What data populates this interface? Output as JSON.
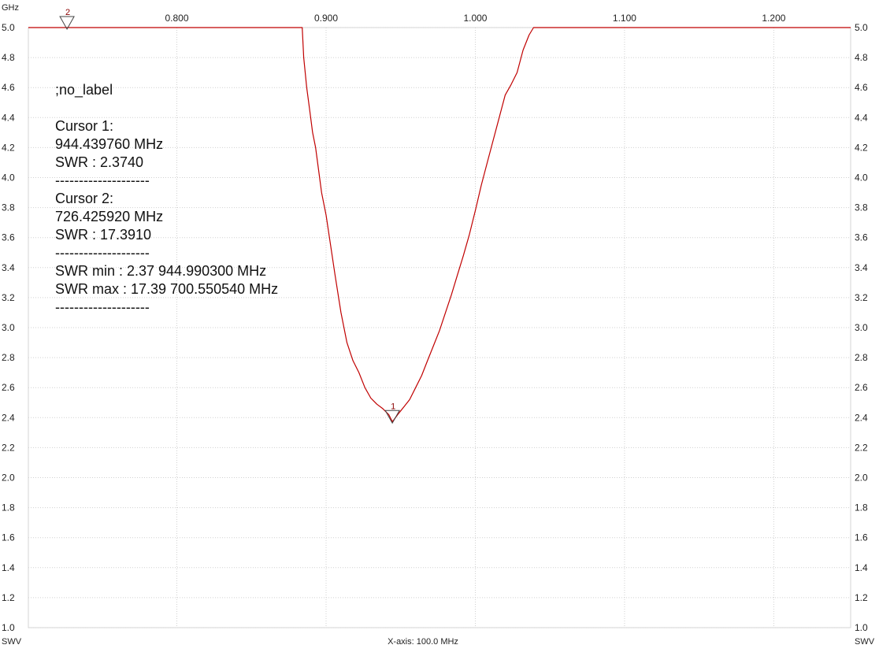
{
  "chart_data": {
    "type": "line",
    "title": "",
    "x_unit_label": "GHz",
    "y_unit_label": "SWV",
    "xlabel": "X-axis: 100.0 MHz",
    "x_range_ghz": [
      0.7005,
      1.2515
    ],
    "ylim": [
      1.0,
      5.0
    ],
    "x_ticks": [
      0.8,
      0.9,
      1.0,
      1.1,
      1.2
    ],
    "x_tick_labels": [
      "0.800",
      "0.900",
      "1.000",
      "1.100",
      "1.200"
    ],
    "y_ticks": [
      1.0,
      1.2,
      1.4,
      1.6,
      1.8,
      2.0,
      2.2,
      2.4,
      2.6,
      2.8,
      3.0,
      3.2,
      3.4,
      3.6,
      3.8,
      4.0,
      4.2,
      4.4,
      4.6,
      4.8,
      5.0
    ],
    "y_tick_labels": [
      "1.0",
      "1.2",
      "1.4",
      "1.6",
      "1.8",
      "2.0",
      "2.2",
      "2.4",
      "2.6",
      "2.8",
      "3.0",
      "3.2",
      "3.4",
      "3.6",
      "3.8",
      "4.0",
      "4.2",
      "4.4",
      "4.6",
      "4.8",
      "5.0"
    ],
    "grid": true,
    "series": [
      {
        "color": "#c00000",
        "x": [
          0.7005,
          0.8,
          0.884,
          0.885,
          0.887,
          0.889,
          0.891,
          0.893,
          0.895,
          0.897,
          0.9,
          0.903,
          0.906,
          0.91,
          0.914,
          0.918,
          0.922,
          0.926,
          0.93,
          0.934,
          0.938,
          0.942,
          0.9444,
          0.945,
          0.948,
          0.952,
          0.956,
          0.96,
          0.964,
          0.968,
          0.972,
          0.976,
          0.98,
          0.984,
          0.988,
          0.992,
          0.996,
          1.0,
          1.004,
          1.008,
          1.012,
          1.016,
          1.02,
          1.024,
          1.028,
          1.032,
          1.036,
          1.039,
          1.2515
        ],
        "y": [
          5.0,
          5.0,
          5.0,
          4.8,
          4.6,
          4.45,
          4.3,
          4.2,
          4.05,
          3.9,
          3.75,
          3.55,
          3.35,
          3.1,
          2.9,
          2.78,
          2.7,
          2.6,
          2.53,
          2.49,
          2.46,
          2.42,
          2.374,
          2.38,
          2.42,
          2.47,
          2.52,
          2.6,
          2.68,
          2.78,
          2.88,
          2.98,
          3.1,
          3.22,
          3.35,
          3.48,
          3.62,
          3.78,
          3.95,
          4.1,
          4.25,
          4.4,
          4.55,
          4.62,
          4.7,
          4.85,
          4.95,
          5.0,
          5.0
        ]
      }
    ],
    "markers": [
      {
        "label": "1",
        "x": 0.9444,
        "y": 2.374
      },
      {
        "label": "2",
        "x": 0.7264,
        "y": 5.0
      }
    ],
    "annotation_lines": [
      ";no_label",
      "",
      "Cursor 1:",
      "944.439760 MHz",
      "SWR : 2.3740",
      "--------------------",
      "Cursor 2:",
      "726.425920 MHz",
      "SWR : 17.3910",
      "--------------------",
      "SWR min : 2.37  944.990300 MHz",
      "SWR max : 17.39  700.550540 MHz",
      "--------------------"
    ]
  }
}
